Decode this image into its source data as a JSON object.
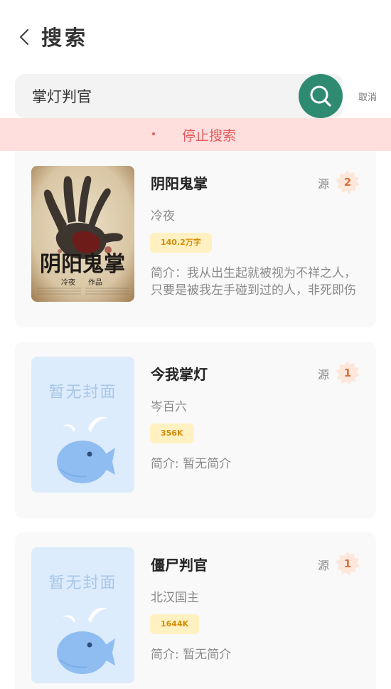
{
  "header": {
    "title": "搜索"
  },
  "search": {
    "value": "掌灯判官",
    "cancel_label": "取消"
  },
  "stop_bar": {
    "label": "停止搜索"
  },
  "colors": {
    "accent": "#2e8b72",
    "stop_bg": "#ffdede",
    "stop_text": "#e05a5a",
    "tag_bg": "#fff1c2",
    "tag_text": "#d48b00"
  },
  "results": [
    {
      "title": "阴阳鬼掌",
      "source_label": "源",
      "source_count": "2",
      "author": "冷夜",
      "word_count": "140.2万字",
      "intro": "简介：我从出生起就被视为不祥之人，只要是被我左手碰到过的人，非死即伤",
      "cover": {
        "has_image": true,
        "art_title": "阴阳鬼掌",
        "art_author": "冷夜",
        "art_suffix": "作品"
      }
    },
    {
      "title": "今我掌灯",
      "source_label": "源",
      "source_count": "1",
      "author": "岑百六",
      "word_count": "356K",
      "intro": "简介: 暂无简介",
      "cover": {
        "has_image": false,
        "placeholder_text": "暂无封面"
      }
    },
    {
      "title": "僵尸判官",
      "source_label": "源",
      "source_count": "1",
      "author": "北汉国主",
      "word_count": "1644K",
      "intro": "简介: 暂无简介",
      "cover": {
        "has_image": false,
        "placeholder_text": "暂无封面"
      }
    }
  ]
}
